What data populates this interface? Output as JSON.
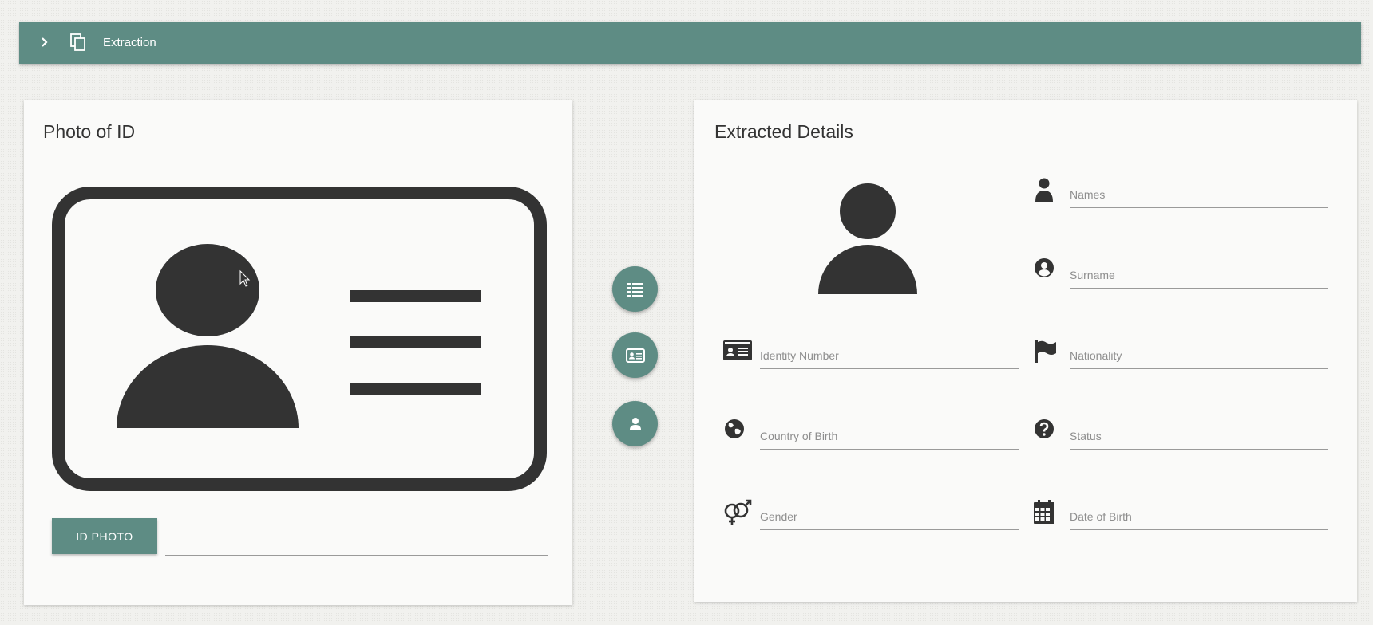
{
  "toolbar": {
    "title": "Extraction",
    "chevron_icon": "chevron-right-icon",
    "copy_icon": "copy-icon",
    "color": "#5e8c84"
  },
  "left_card": {
    "title": "Photo of ID",
    "illustration": "id-card-icon",
    "button_label": "ID PHOTO",
    "file_value": ""
  },
  "stepper": {
    "steps": [
      {
        "icon": "list-icon"
      },
      {
        "icon": "id-card-icon"
      },
      {
        "icon": "person-icon"
      }
    ]
  },
  "right_card": {
    "title": "Extracted Details",
    "avatar_icon": "person-silhouette-icon",
    "fields": {
      "names": {
        "placeholder": "Names",
        "value": "",
        "icon": "person-icon"
      },
      "surname": {
        "placeholder": "Surname",
        "value": "",
        "icon": "account-circle-icon"
      },
      "identity_number": {
        "placeholder": "Identity Number",
        "value": "",
        "icon": "id-card-icon"
      },
      "nationality": {
        "placeholder": "Nationality",
        "value": "",
        "icon": "flag-icon"
      },
      "country_of_birth": {
        "placeholder": "Country of Birth",
        "value": "",
        "icon": "globe-icon"
      },
      "status": {
        "placeholder": "Status",
        "value": "",
        "icon": "help-icon"
      },
      "gender": {
        "placeholder": "Gender",
        "value": "",
        "icon": "gender-icon"
      },
      "date_of_birth": {
        "placeholder": "Date of Birth",
        "value": "",
        "icon": "calendar-icon"
      }
    }
  }
}
